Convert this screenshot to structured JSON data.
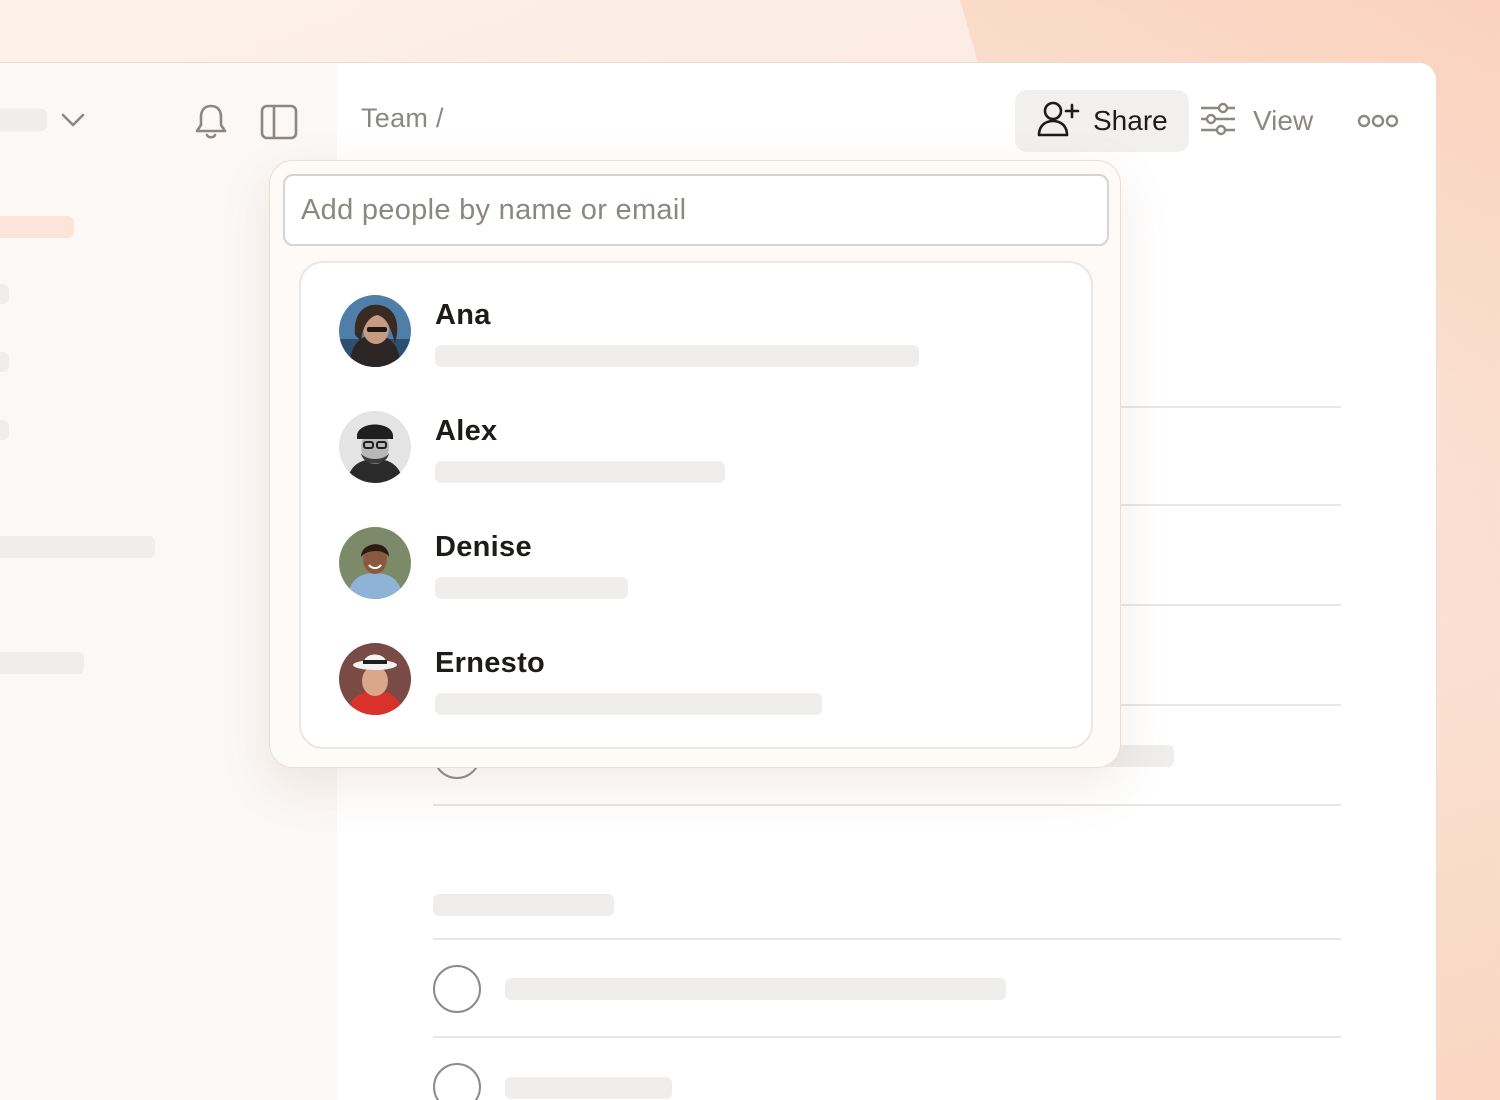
{
  "header": {
    "breadcrumb": "Team /",
    "share_label": "Share",
    "view_label": "View"
  },
  "icons": {
    "notification": "bell-icon",
    "sidebar_toggle": "sidebar-panel-icon",
    "workspace_menu": "chevron-down-icon",
    "share": "add-user-icon",
    "view": "sliders-icon",
    "more": "more-horizontal-icon"
  },
  "share_popover": {
    "search_placeholder": "Add people by name or email",
    "people": [
      {
        "name": "Ana"
      },
      {
        "name": "Alex"
      },
      {
        "name": "Denise"
      },
      {
        "name": "Ernesto"
      }
    ]
  },
  "colors": {
    "accent_peach": "#fde4d8",
    "text_primary": "#1f1b19",
    "text_muted": "#8d8783"
  }
}
